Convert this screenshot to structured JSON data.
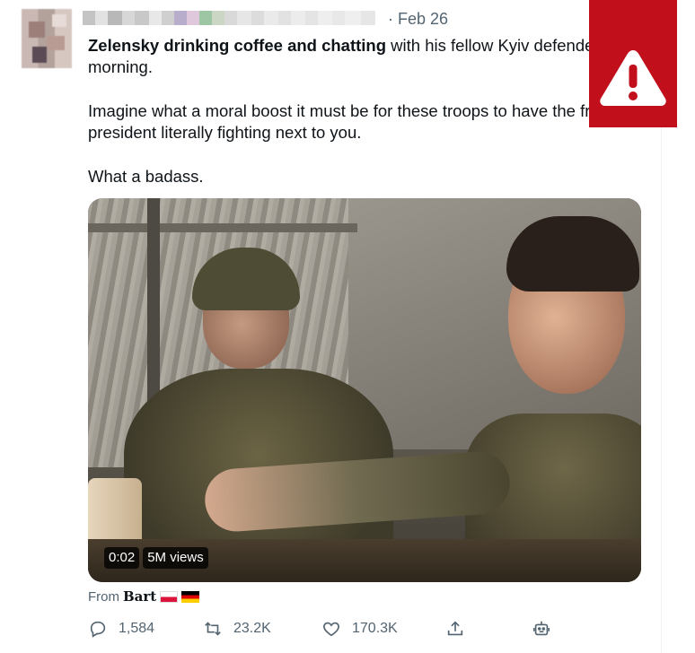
{
  "tweet": {
    "date": "· Feb 26",
    "text_bold": "Zelensky drinking coffee and chatting",
    "text_line1_rest": " with his fellow Kyiv defender",
    "text_line2": "morning.",
    "text_line3": "Imagine what a moral boost it must be for these troops to have the fr",
    "text_line4": "president literally fighting next to you.",
    "text_line5": "What a badass."
  },
  "media": {
    "duration": "0:02",
    "views": "5M views"
  },
  "source": {
    "prefix": "From",
    "app": "Bart"
  },
  "actions": {
    "replies": "1,584",
    "retweets": "23.2K",
    "likes": "170.3K"
  },
  "colors": {
    "warning": "#c1101b",
    "muted": "#536471",
    "text": "#0f1419"
  },
  "icons": [
    "warning-icon",
    "reply-icon",
    "retweet-icon",
    "like-icon",
    "share-icon",
    "bot-icon"
  ]
}
